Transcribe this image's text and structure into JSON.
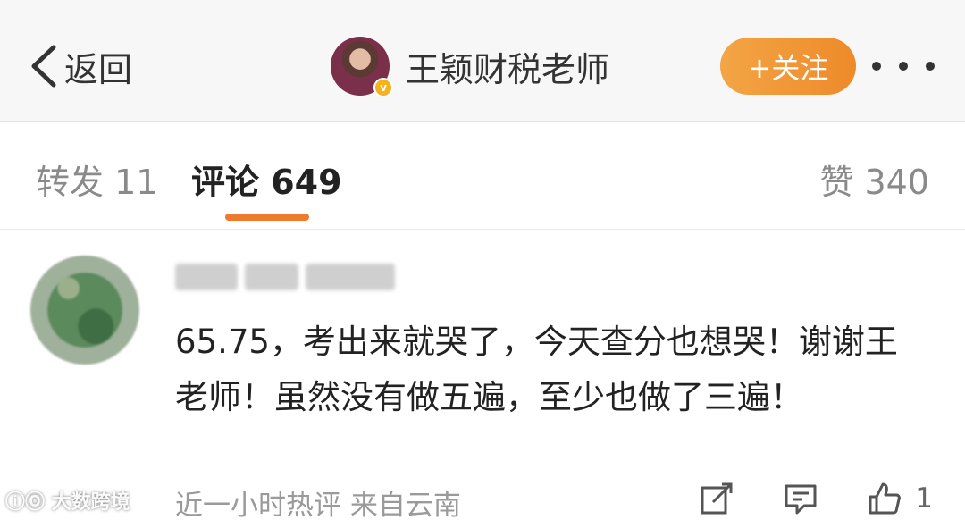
{
  "header": {
    "back_label": "返回",
    "author_name": "王颖财税老师",
    "follow_label": "+关注",
    "verified_mark": "v"
  },
  "tabs": {
    "repost": "转发 11",
    "comments": "评论 649",
    "likes": "赞 340"
  },
  "comment": {
    "text": "65.75，考出来就哭了，今天查分也想哭！谢谢王老师！虽然没有做五遍，至少也做了三遍！",
    "meta": "近一小时热评  来自云南",
    "like_count": "1"
  },
  "watermark": "ⓘⓄ 大数跨境",
  "icons": [
    "chevron-left-icon",
    "more-icon",
    "edit-share-icon",
    "comment-icon",
    "thumbs-up-icon"
  ],
  "colors": {
    "accent": "#ee7a2d",
    "follow_gradient_start": "#f3a545",
    "follow_gradient_end": "#ee8a2a",
    "header_bg": "#f7f7f7"
  }
}
